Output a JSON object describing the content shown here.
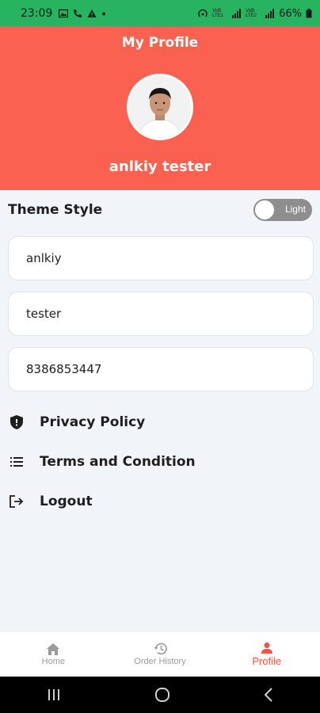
{
  "status_bar": {
    "time": "23:09",
    "battery": "66%",
    "network_1": "VoB LTE1",
    "network_2": "VoB LTE2"
  },
  "header": {
    "title": "My Profile",
    "name": "anlkiy tester",
    "background_color": "#fa6151"
  },
  "theme": {
    "label": "Theme Style",
    "toggle_text": "Light"
  },
  "fields": {
    "first_name": "anlkiy",
    "last_name": "tester",
    "phone": "8386853447"
  },
  "menu": {
    "privacy": "Privacy Policy",
    "terms": "Terms and Condition",
    "logout": "Logout"
  },
  "bottom_nav": {
    "home": "Home",
    "order_history": "Order History",
    "profile": "Profile",
    "active": "Profile",
    "active_color": "#f35343"
  }
}
